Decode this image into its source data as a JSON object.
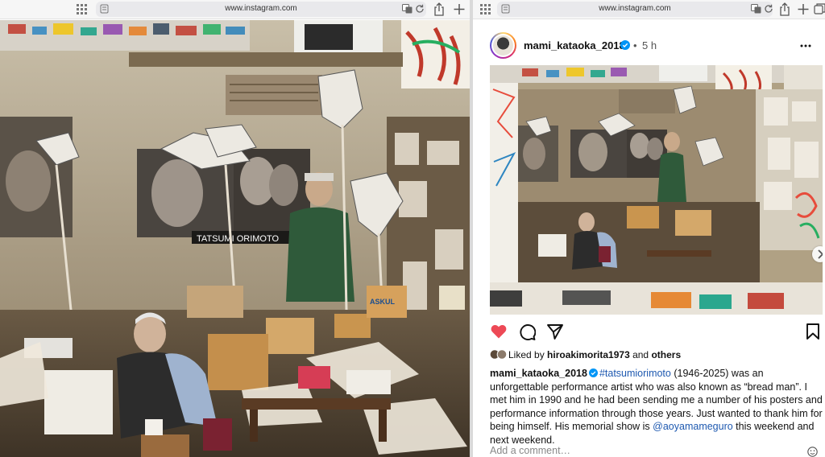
{
  "left_window": {
    "url": "www.instagram.com"
  },
  "right_window": {
    "url": "www.instagram.com"
  },
  "post": {
    "username": "mami_kataoka_2018",
    "time_separator": "•",
    "time": "5 h",
    "carousel": {
      "count": 6,
      "active_index": 0
    },
    "liked_prefix": "Liked by ",
    "liked_user": "hiroakimorita1973",
    "liked_and": " and ",
    "liked_others": "others",
    "caption": {
      "username": "mami_kataoka_2018",
      "hashtag": "#tatsumiorimoto",
      "text1": " (1946-2025) was an unforgettable performance artist who was also known as “bread man”. I met him in 1990 and he had been sending me a number of his posters and performance information through those years. Just wanted to thank him for being himself. His memorial show is ",
      "mention": "@aoyamameguro",
      "text2": " this weekend and next weekend."
    },
    "comment_placeholder": "Add a comment…"
  },
  "photo": {
    "sign_text": "TATSUMI ORIMOTO",
    "box_text": "ASKUL"
  },
  "colors": {
    "like_red": "#ed4956",
    "link_blue": "#1e59b0",
    "verified_blue": "#0095f6"
  },
  "icons": [
    "grid-icon",
    "page-icon",
    "translate-icon",
    "reload-icon",
    "share-icon",
    "new-tab-icon",
    "tabs-icon",
    "verified-icon",
    "more-icon",
    "heart-icon",
    "comment-icon",
    "share-plane-icon",
    "bookmark-icon",
    "chevron-right-icon",
    "emoji-icon"
  ]
}
